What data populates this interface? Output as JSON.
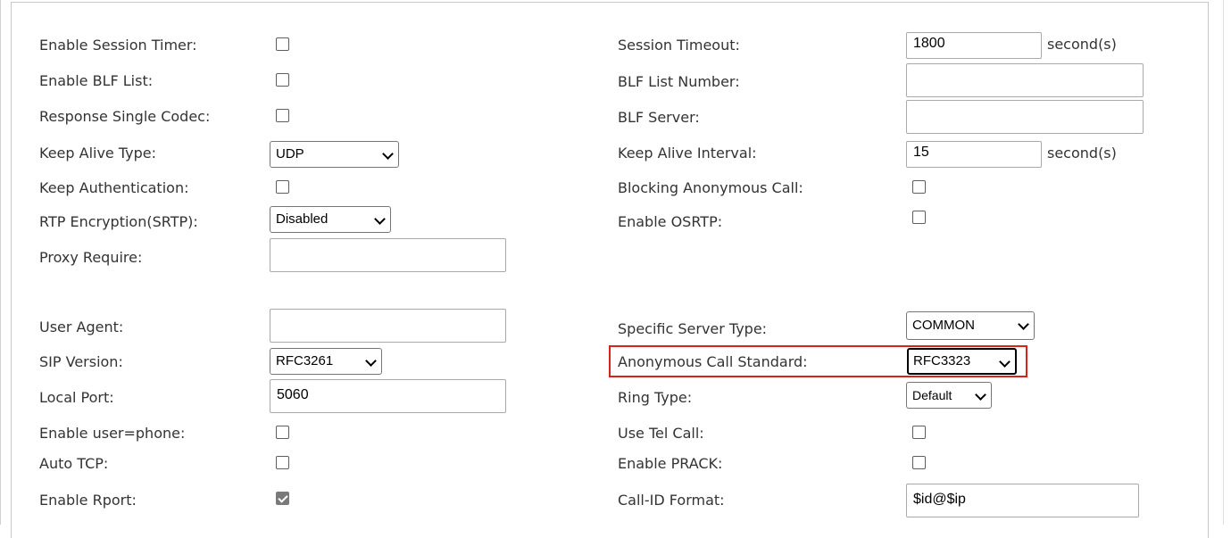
{
  "left": {
    "enable_session_timer": {
      "label": "Enable Session Timer:",
      "checked": false
    },
    "enable_blf_list": {
      "label": "Enable BLF List:",
      "checked": false
    },
    "response_single_codec": {
      "label": "Response Single Codec:",
      "checked": false
    },
    "keep_alive_type": {
      "label": "Keep Alive Type:",
      "value": "UDP"
    },
    "keep_authentication": {
      "label": "Keep Authentication:",
      "checked": false
    },
    "rtp_encryption": {
      "label": "RTP Encryption(SRTP):",
      "value": "Disabled"
    },
    "proxy_require": {
      "label": "Proxy Require:",
      "value": ""
    },
    "user_agent": {
      "label": "User Agent:",
      "value": ""
    },
    "sip_version": {
      "label": "SIP Version:",
      "value": "RFC3261"
    },
    "local_port": {
      "label": "Local Port:",
      "value": "5060"
    },
    "enable_user_phone": {
      "label": "Enable user=phone:",
      "checked": false
    },
    "auto_tcp": {
      "label": "Auto TCP:",
      "checked": false
    },
    "enable_rport": {
      "label": "Enable Rport:",
      "checked": true
    }
  },
  "right": {
    "session_timeout": {
      "label": "Session Timeout:",
      "value": "1800",
      "unit": "second(s)"
    },
    "blf_list_number": {
      "label": "BLF List Number:",
      "value": ""
    },
    "blf_server": {
      "label": "BLF Server:",
      "value": ""
    },
    "keep_alive_interval": {
      "label": "Keep Alive Interval:",
      "value": "15",
      "unit": "second(s)"
    },
    "blocking_anonymous_call": {
      "label": "Blocking Anonymous Call:",
      "checked": false
    },
    "enable_osrtp": {
      "label": "Enable OSRTP:",
      "checked": false
    },
    "specific_server_type": {
      "label": "Specific Server Type:",
      "value": "COMMON"
    },
    "anonymous_call_standard": {
      "label": "Anonymous Call Standard:",
      "value": "RFC3323"
    },
    "ring_type": {
      "label": "Ring Type:",
      "value": "Default"
    },
    "use_tel_call": {
      "label": "Use Tel Call:",
      "checked": false
    },
    "enable_prack": {
      "label": "Enable PRACK:",
      "checked": false
    },
    "call_id_format": {
      "label": "Call-ID Format:",
      "value": "$id@$ip"
    }
  },
  "colors": {
    "highlight": "#d9221c",
    "text": "#333333",
    "border": "#a9a9a9"
  }
}
